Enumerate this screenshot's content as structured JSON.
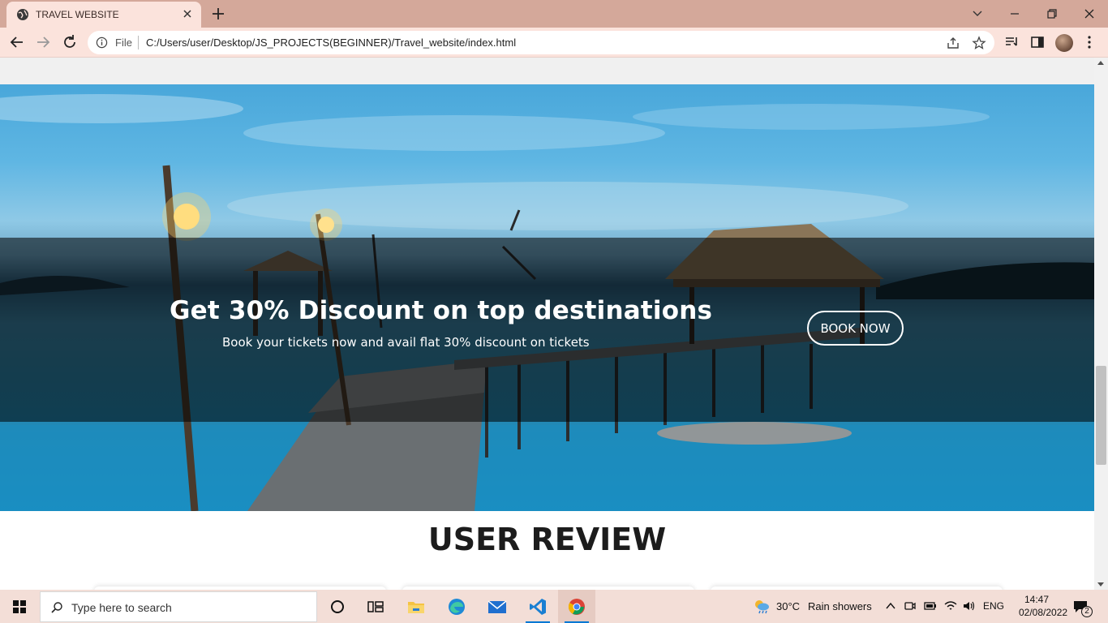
{
  "browser": {
    "tab_title": "TRAVEL WEBSITE",
    "omnibox": {
      "scheme_label": "File",
      "url": "C:/Users/user/Desktop/JS_PROJECTS(BEGINNER)/Travel_website/index.html"
    }
  },
  "page": {
    "hero": {
      "title": "Get 30% Discount on top destinations",
      "subtitle": "Book your tickets now and avail flat 30% discount on tickets",
      "button_label": "BOOK NOW"
    },
    "reviews_title": "USER REVIEW",
    "scroll_position": 0.58
  },
  "taskbar": {
    "search_placeholder": "Type here to search",
    "apps": [
      "cortana-icon",
      "task-view-icon",
      "file-explorer-icon",
      "edge-icon",
      "mail-icon",
      "vscode-icon",
      "chrome-icon"
    ],
    "weather": {
      "temp": "30°C",
      "condition": "Rain showers"
    },
    "language": "ENG",
    "time": "14:47",
    "date": "02/08/2022",
    "notification_count": "2"
  },
  "colors": {
    "titlebar": "#d4a89a",
    "toolbar": "#fbe3dc",
    "taskbar": "#f3ded7",
    "accent": "#0078d4"
  }
}
